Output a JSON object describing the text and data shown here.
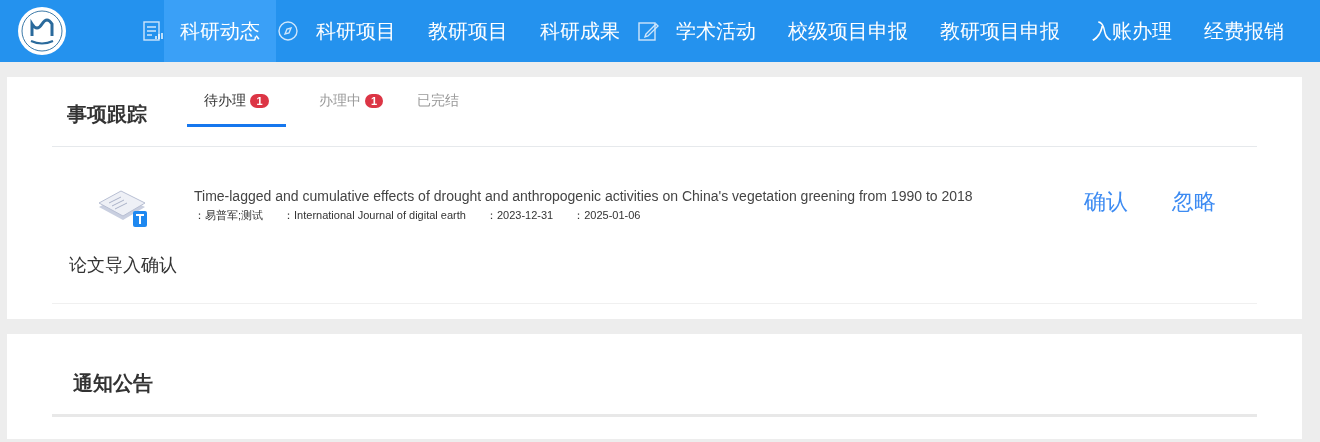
{
  "nav": [
    {
      "kind": "icon"
    },
    {
      "kind": "link",
      "label": "科研动态",
      "selected": true
    },
    {
      "kind": "icon"
    },
    {
      "kind": "link",
      "label": "科研项目",
      "selected": false
    },
    {
      "kind": "link",
      "label": "教研项目",
      "selected": false
    },
    {
      "kind": "link",
      "label": "科研成果",
      "selected": false
    },
    {
      "kind": "icon"
    },
    {
      "kind": "link",
      "label": "学术活动",
      "selected": false
    },
    {
      "kind": "link",
      "label": "校级项目申报",
      "selected": false
    },
    {
      "kind": "link",
      "label": "教研项目申报",
      "selected": false
    },
    {
      "kind": "link",
      "label": "入账办理",
      "selected": false
    },
    {
      "kind": "link",
      "label": "经费报销",
      "selected": false
    }
  ],
  "tracking": {
    "title": "事项跟踪",
    "tabs": [
      {
        "label": "待办理",
        "badge": "1",
        "selected": true
      },
      {
        "label": "办理中",
        "badge": "1",
        "selected": false
      },
      {
        "label": "已完结",
        "selected": false
      }
    ],
    "items": [
      {
        "type_label": "论文导入确认",
        "title": "Time-lagged and cumulative effects of drought and anthropogenic activities on China's vegetation greening from 1990 to 2018",
        "meta": [
          "：易普军;测试",
          "：International Journal of digital earth",
          "：2023-12-31",
          "：2025-01-06"
        ],
        "actions": [
          "确认",
          "忽略"
        ]
      }
    ]
  },
  "notices": {
    "title": "通知公告"
  }
}
